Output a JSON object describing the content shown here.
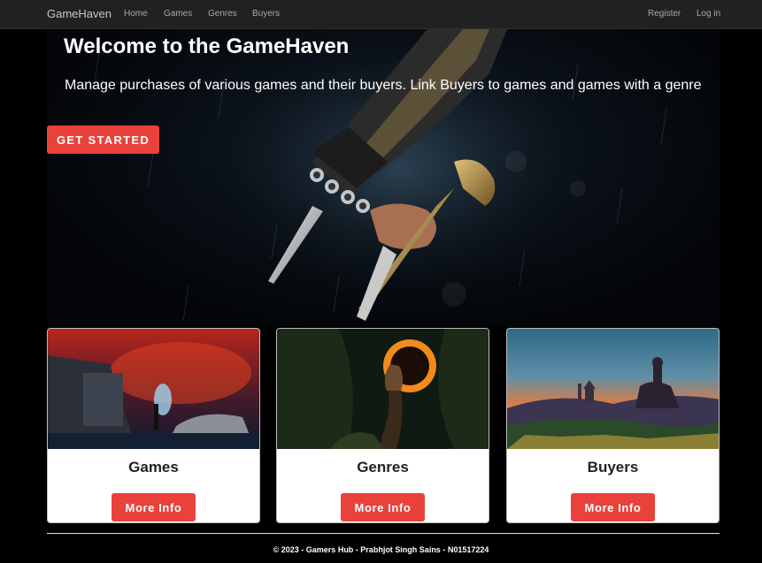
{
  "nav": {
    "brand": "GameHaven",
    "links": [
      "Home",
      "Games",
      "Genres",
      "Buyers"
    ],
    "register": "Register",
    "login": "Log in"
  },
  "hero": {
    "title": "Welcome to the GameHaven",
    "subtitle": "Manage purchases of various games and their buyers. Link Buyers to games and games with a genre",
    "cta": "GET STARTED"
  },
  "cards": [
    {
      "title": "Games",
      "button": "More Info"
    },
    {
      "title": "Genres",
      "button": "More Info"
    },
    {
      "title": "Buyers",
      "button": "More Info"
    }
  ],
  "footer": {
    "text": "© 2023 - Gamers Hub - Prabhjot Singh Sains - N01517224"
  },
  "colors": {
    "navbar": "#212121",
    "accent": "#e8423b",
    "page_bg": "#000000",
    "card_bg": "#ffffff"
  }
}
